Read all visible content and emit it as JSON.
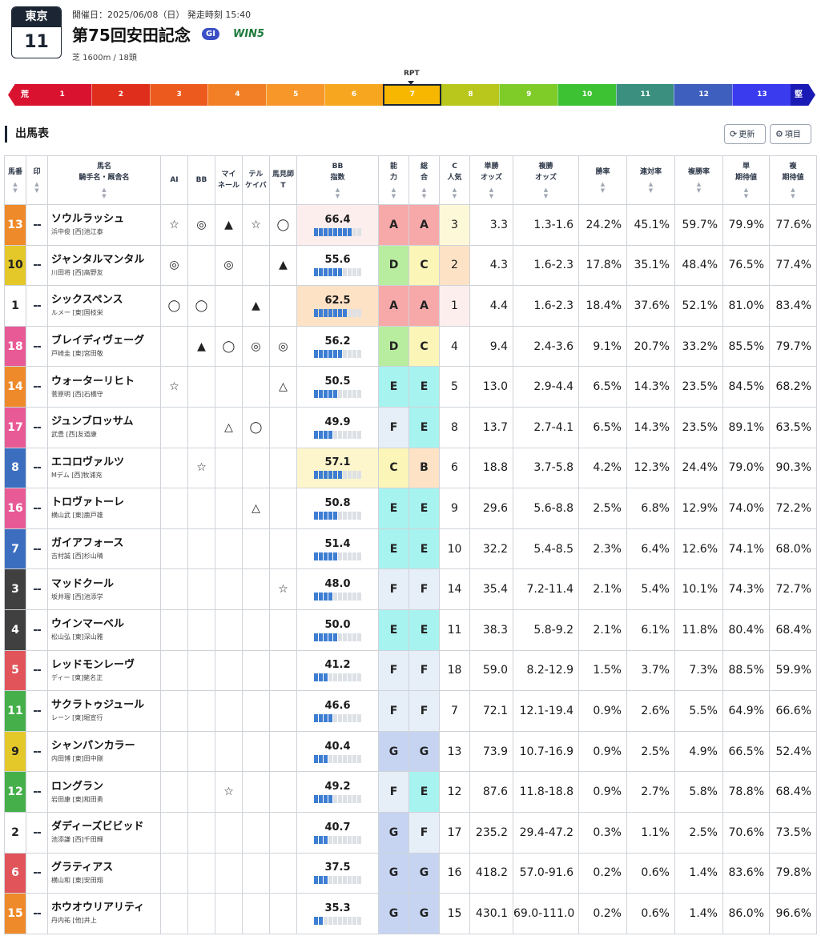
{
  "header": {
    "venue": "東京",
    "race_number": "11",
    "date_line": "開催日：2025/06/08（日） 発走時刻 15:40",
    "title": "第75回安田記念",
    "grade": "GI",
    "win5": "WIN5",
    "subtitle": "芝 1600m / 18頭"
  },
  "scale": {
    "marker_label": "RPT",
    "left_label": "荒",
    "right_label": "堅",
    "active_index": 6,
    "segments": [
      {
        "label": "1",
        "color": "#d9132f"
      },
      {
        "label": "2",
        "color": "#e02e1c"
      },
      {
        "label": "3",
        "color": "#ec5a1e"
      },
      {
        "label": "4",
        "color": "#f27f25"
      },
      {
        "label": "5",
        "color": "#f7972a"
      },
      {
        "label": "6",
        "color": "#f7a71f"
      },
      {
        "label": "7",
        "color": "#f7b700"
      },
      {
        "label": "8",
        "color": "#b9c61b"
      },
      {
        "label": "9",
        "color": "#7fcc29"
      },
      {
        "label": "10",
        "color": "#3dc233"
      },
      {
        "label": "11",
        "color": "#3a8f7e"
      },
      {
        "label": "12",
        "color": "#3f5fbf"
      },
      {
        "label": "13",
        "color": "#3a3aef"
      }
    ]
  },
  "section": {
    "title": "出馬表",
    "refresh_label": "更新",
    "columns_label": "項目"
  },
  "table": {
    "headers": {
      "umaban": "馬番",
      "mark": "印",
      "name": "馬名",
      "name_sub": "騎手名・厩舎名",
      "ai": "AI",
      "bb": "BB",
      "mile1": "マイ",
      "mile2": "ネール",
      "tel1": "テル",
      "tel2": "ケイバ",
      "pro1": "馬見師",
      "pro2": "T",
      "bbi1": "BB",
      "bbi2": "指数",
      "abi1": "能",
      "abi2": "力",
      "tot1": "総",
      "tot2": "合",
      "cnk1": "C",
      "cnk2": "人気",
      "win1": "単勝",
      "win2": "オッズ",
      "plc1": "複勝",
      "plc2": "オッズ",
      "winrate": "勝率",
      "quinrate": "連対率",
      "plcrate": "複勝率",
      "ev1a": "単",
      "ev1b": "期待値",
      "ev2a": "複",
      "ev2b": "期待値"
    },
    "rows": [
      {
        "num": "13",
        "color": "#ef8a2a",
        "mark": "--",
        "name": "ソウルラッシュ",
        "sub": "浜中俊 [西]池江泰",
        "ai": "☆",
        "bb": "◎",
        "mile": "▲",
        "tel": "☆",
        "pro": "◯",
        "bbi": "66.4",
        "bbi_bars": 8,
        "bbi_bg": "#fdeeee",
        "abi": "A",
        "abi_bg": "#f7a9a9",
        "tot": "A",
        "tot_bg": "#f7a9a9",
        "cnk": "3",
        "cnk_bg": "#fdf8d8",
        "win": "3.3",
        "plc": "1.3-1.6",
        "winrate": "24.2%",
        "quinrate": "45.1%",
        "plcrate": "59.7%",
        "ev1": "79.9%",
        "ev2": "77.6%"
      },
      {
        "num": "10",
        "color": "#e4c82a",
        "mark": "--",
        "name": "ジャンタルマンタル",
        "sub": "川田将 [西]高野友",
        "ai": "◎",
        "bb": "",
        "mile": "◎",
        "tel": "",
        "pro": "▲",
        "bbi": "55.6",
        "bbi_bars": 6,
        "bbi_bg": "#ffffff",
        "abi": "D",
        "abi_bg": "#b8ec9e",
        "tot": "C",
        "tot_bg": "#fbf6b7",
        "cnk": "2",
        "cnk_bg": "#fde2c6",
        "win": "4.3",
        "plc": "1.6-2.3",
        "winrate": "17.8%",
        "quinrate": "35.1%",
        "plcrate": "48.4%",
        "ev1": "76.5%",
        "ev2": "77.4%"
      },
      {
        "num": "1",
        "color": "#ffffff",
        "mark": "--",
        "name": "シックスペンス",
        "sub": "ルメー [東]国枝栄",
        "ai": "◯",
        "bb": "◯",
        "mile": "",
        "tel": "▲",
        "pro": "",
        "bbi": "62.5",
        "bbi_bars": 7,
        "bbi_bg": "#fde2c6",
        "abi": "A",
        "abi_bg": "#f7a9a9",
        "tot": "A",
        "tot_bg": "#f7a9a9",
        "cnk": "1",
        "cnk_bg": "#fdeeee",
        "win": "4.4",
        "plc": "1.6-2.3",
        "winrate": "18.4%",
        "quinrate": "37.6%",
        "plcrate": "52.1%",
        "ev1": "81.0%",
        "ev2": "83.4%"
      },
      {
        "num": "18",
        "color": "#e85a95",
        "mark": "--",
        "name": "ブレイディヴェーグ",
        "sub": "戸崎圭 [東]宮田敬",
        "ai": "",
        "bb": "▲",
        "mile": "◯",
        "tel": "◎",
        "pro": "◎",
        "bbi": "56.2",
        "bbi_bars": 6,
        "bbi_bg": "#ffffff",
        "abi": "D",
        "abi_bg": "#b8ec9e",
        "tot": "C",
        "tot_bg": "#fbf6b7",
        "cnk": "4",
        "cnk_bg": "#ffffff",
        "win": "9.4",
        "plc": "2.4-3.6",
        "winrate": "9.1%",
        "quinrate": "20.7%",
        "plcrate": "33.2%",
        "ev1": "85.5%",
        "ev2": "79.7%"
      },
      {
        "num": "14",
        "color": "#ef8a2a",
        "mark": "--",
        "name": "ウォーターリヒト",
        "sub": "菅原明 [西]石橋守",
        "ai": "☆",
        "bb": "",
        "mile": "",
        "tel": "",
        "pro": "△",
        "bbi": "50.5",
        "bbi_bars": 5,
        "bbi_bg": "#ffffff",
        "abi": "E",
        "abi_bg": "#a7f3f0",
        "tot": "E",
        "tot_bg": "#a7f3f0",
        "cnk": "5",
        "cnk_bg": "#ffffff",
        "win": "13.0",
        "plc": "2.9-4.4",
        "winrate": "6.5%",
        "quinrate": "14.3%",
        "plcrate": "23.5%",
        "ev1": "84.5%",
        "ev2": "68.2%"
      },
      {
        "num": "17",
        "color": "#e85a95",
        "mark": "--",
        "name": "ジュンブロッサム",
        "sub": "武豊 [西]友道康",
        "ai": "",
        "bb": "",
        "mile": "△",
        "tel": "◯",
        "pro": "",
        "bbi": "49.9",
        "bbi_bars": 4,
        "bbi_bg": "#ffffff",
        "abi": "F",
        "abi_bg": "#e6eef8",
        "tot": "E",
        "tot_bg": "#a7f3f0",
        "cnk": "8",
        "cnk_bg": "#ffffff",
        "win": "13.7",
        "plc": "2.7-4.1",
        "winrate": "6.5%",
        "quinrate": "14.3%",
        "plcrate": "23.5%",
        "ev1": "89.1%",
        "ev2": "63.5%"
      },
      {
        "num": "8",
        "color": "#3c6ec0",
        "mark": "--",
        "name": "エコロヴァルツ",
        "sub": "Mデム [西]牧浦充",
        "ai": "",
        "bb": "☆",
        "mile": "",
        "tel": "",
        "pro": "",
        "bbi": "57.1",
        "bbi_bars": 6,
        "bbi_bg": "#fdf6cc",
        "abi": "C",
        "abi_bg": "#fbf6b7",
        "tot": "B",
        "tot_bg": "#fde2c6",
        "cnk": "6",
        "cnk_bg": "#ffffff",
        "win": "18.8",
        "plc": "3.7-5.8",
        "winrate": "4.2%",
        "quinrate": "12.3%",
        "plcrate": "24.4%",
        "ev1": "79.0%",
        "ev2": "90.3%"
      },
      {
        "num": "16",
        "color": "#e85a95",
        "mark": "--",
        "name": "トロヴァトーレ",
        "sub": "横山武 [東]鹿戸雄",
        "ai": "",
        "bb": "",
        "mile": "",
        "tel": "△",
        "pro": "",
        "bbi": "50.8",
        "bbi_bars": 5,
        "bbi_bg": "#ffffff",
        "abi": "E",
        "abi_bg": "#a7f3f0",
        "tot": "E",
        "tot_bg": "#a7f3f0",
        "cnk": "9",
        "cnk_bg": "#ffffff",
        "win": "29.6",
        "plc": "5.6-8.8",
        "winrate": "2.5%",
        "quinrate": "6.8%",
        "plcrate": "12.9%",
        "ev1": "74.0%",
        "ev2": "72.2%"
      },
      {
        "num": "7",
        "color": "#3c6ec0",
        "mark": "--",
        "name": "ガイアフォース",
        "sub": "吉村誠 [西]杉山晴",
        "ai": "",
        "bb": "",
        "mile": "",
        "tel": "",
        "pro": "",
        "bbi": "51.4",
        "bbi_bars": 5,
        "bbi_bg": "#ffffff",
        "abi": "E",
        "abi_bg": "#a7f3f0",
        "tot": "E",
        "tot_bg": "#a7f3f0",
        "cnk": "10",
        "cnk_bg": "#ffffff",
        "win": "32.2",
        "plc": "5.4-8.5",
        "winrate": "2.3%",
        "quinrate": "6.4%",
        "plcrate": "12.6%",
        "ev1": "74.1%",
        "ev2": "68.0%"
      },
      {
        "num": "3",
        "color": "#404040",
        "mark": "--",
        "name": "マッドクール",
        "sub": "坂井瑠 [西]池添学",
        "ai": "",
        "bb": "",
        "mile": "",
        "tel": "",
        "pro": "☆",
        "bbi": "48.0",
        "bbi_bars": 4,
        "bbi_bg": "#ffffff",
        "abi": "F",
        "abi_bg": "#e6eef8",
        "tot": "F",
        "tot_bg": "#e6eef8",
        "cnk": "14",
        "cnk_bg": "#ffffff",
        "win": "35.4",
        "plc": "7.2-11.4",
        "winrate": "2.1%",
        "quinrate": "5.4%",
        "plcrate": "10.1%",
        "ev1": "74.3%",
        "ev2": "72.7%"
      },
      {
        "num": "4",
        "color": "#404040",
        "mark": "--",
        "name": "ウインマーベル",
        "sub": "松山弘 [東]深山雅",
        "ai": "",
        "bb": "",
        "mile": "",
        "tel": "",
        "pro": "",
        "bbi": "50.0",
        "bbi_bars": 5,
        "bbi_bg": "#ffffff",
        "abi": "E",
        "abi_bg": "#a7f3f0",
        "tot": "E",
        "tot_bg": "#a7f3f0",
        "cnk": "11",
        "cnk_bg": "#ffffff",
        "win": "38.3",
        "plc": "5.8-9.2",
        "winrate": "2.1%",
        "quinrate": "6.1%",
        "plcrate": "11.8%",
        "ev1": "80.4%",
        "ev2": "68.4%"
      },
      {
        "num": "5",
        "color": "#e0545a",
        "mark": "--",
        "name": "レッドモンレーヴ",
        "sub": "ディー [東]蛯名正",
        "ai": "",
        "bb": "",
        "mile": "",
        "tel": "",
        "pro": "",
        "bbi": "41.2",
        "bbi_bars": 3,
        "bbi_bg": "#ffffff",
        "abi": "F",
        "abi_bg": "#e6eef8",
        "tot": "F",
        "tot_bg": "#e6eef8",
        "cnk": "18",
        "cnk_bg": "#ffffff",
        "win": "59.0",
        "plc": "8.2-12.9",
        "winrate": "1.5%",
        "quinrate": "3.7%",
        "plcrate": "7.3%",
        "ev1": "88.5%",
        "ev2": "59.9%"
      },
      {
        "num": "11",
        "color": "#45b04a",
        "mark": "--",
        "name": "サクラトゥジュール",
        "sub": "レーン [東]堀宣行",
        "ai": "",
        "bb": "",
        "mile": "",
        "tel": "",
        "pro": "",
        "bbi": "46.6",
        "bbi_bars": 4,
        "bbi_bg": "#ffffff",
        "abi": "F",
        "abi_bg": "#e6eef8",
        "tot": "F",
        "tot_bg": "#e6eef8",
        "cnk": "7",
        "cnk_bg": "#ffffff",
        "win": "72.1",
        "plc": "12.1-19.4",
        "winrate": "0.9%",
        "quinrate": "2.6%",
        "plcrate": "5.5%",
        "ev1": "64.9%",
        "ev2": "66.6%"
      },
      {
        "num": "9",
        "color": "#e4c82a",
        "mark": "--",
        "name": "シャンパンカラー",
        "sub": "内田博 [東]田中剛",
        "ai": "",
        "bb": "",
        "mile": "",
        "tel": "",
        "pro": "",
        "bbi": "40.4",
        "bbi_bars": 3,
        "bbi_bg": "#ffffff",
        "abi": "G",
        "abi_bg": "#c6d4f2",
        "tot": "G",
        "tot_bg": "#c6d4f2",
        "cnk": "13",
        "cnk_bg": "#ffffff",
        "win": "73.9",
        "plc": "10.7-16.9",
        "winrate": "0.9%",
        "quinrate": "2.5%",
        "plcrate": "4.9%",
        "ev1": "66.5%",
        "ev2": "52.4%"
      },
      {
        "num": "12",
        "color": "#45b04a",
        "mark": "--",
        "name": "ロングラン",
        "sub": "岩田康 [東]和田勇",
        "ai": "",
        "bb": "",
        "mile": "☆",
        "tel": "",
        "pro": "",
        "bbi": "49.2",
        "bbi_bars": 4,
        "bbi_bg": "#ffffff",
        "abi": "F",
        "abi_bg": "#e6eef8",
        "tot": "E",
        "tot_bg": "#a7f3f0",
        "cnk": "12",
        "cnk_bg": "#ffffff",
        "win": "87.6",
        "plc": "11.8-18.8",
        "winrate": "0.9%",
        "quinrate": "2.7%",
        "plcrate": "5.8%",
        "ev1": "78.8%",
        "ev2": "68.4%"
      },
      {
        "num": "2",
        "color": "#ffffff",
        "mark": "--",
        "name": "ダディーズビビッド",
        "sub": "池添謙 [西]千田輝",
        "ai": "",
        "bb": "",
        "mile": "",
        "tel": "",
        "pro": "",
        "bbi": "40.7",
        "bbi_bars": 3,
        "bbi_bg": "#ffffff",
        "abi": "G",
        "abi_bg": "#c6d4f2",
        "tot": "F",
        "tot_bg": "#e6eef8",
        "cnk": "17",
        "cnk_bg": "#ffffff",
        "win": "235.2",
        "plc": "29.4-47.2",
        "winrate": "0.3%",
        "quinrate": "1.1%",
        "plcrate": "2.5%",
        "ev1": "70.6%",
        "ev2": "73.5%"
      },
      {
        "num": "6",
        "color": "#e0545a",
        "mark": "--",
        "name": "グラティアス",
        "sub": "横山和 [東]安田翔",
        "ai": "",
        "bb": "",
        "mile": "",
        "tel": "",
        "pro": "",
        "bbi": "37.5",
        "bbi_bars": 3,
        "bbi_bg": "#ffffff",
        "abi": "G",
        "abi_bg": "#c6d4f2",
        "tot": "G",
        "tot_bg": "#c6d4f2",
        "cnk": "16",
        "cnk_bg": "#ffffff",
        "win": "418.2",
        "plc": "57.0-91.6",
        "winrate": "0.2%",
        "quinrate": "0.6%",
        "plcrate": "1.4%",
        "ev1": "83.6%",
        "ev2": "79.8%"
      },
      {
        "num": "15",
        "color": "#ef8a2a",
        "mark": "--",
        "name": "ホウオウリアリティ",
        "sub": "丹内祐 [他]井上",
        "ai": "",
        "bb": "",
        "mile": "",
        "tel": "",
        "pro": "",
        "bbi": "35.3",
        "bbi_bars": 2,
        "bbi_bg": "#ffffff",
        "abi": "G",
        "abi_bg": "#c6d4f2",
        "tot": "G",
        "tot_bg": "#c6d4f2",
        "cnk": "15",
        "cnk_bg": "#ffffff",
        "win": "430.1",
        "plc": "69.0-111.0",
        "winrate": "0.2%",
        "quinrate": "0.6%",
        "plcrate": "1.4%",
        "ev1": "86.0%",
        "ev2": "96.6%"
      }
    ]
  }
}
